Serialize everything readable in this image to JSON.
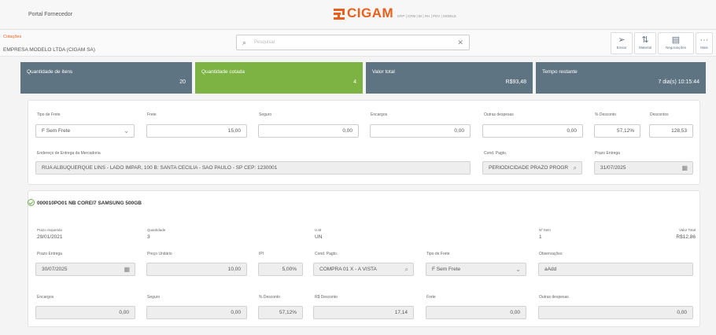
{
  "header": {
    "portal_title": "Portal Fornecedor",
    "brand": "CIGAM",
    "brand_subtitle": "ERP | CRM | BI | RH | PDV | MOBILE",
    "brand_color": "#e8601c"
  },
  "subheader": {
    "breadcrumb": "Cotações",
    "company": "EMPRESA MODELO LTDA (CIGAM SA)",
    "search_placeholder": "Pesquisar"
  },
  "toolbar": {
    "send_label": "Enviar",
    "send_icon": "send-icon",
    "material_label": "Material",
    "material_icon": "sort-arrows-icon",
    "negotiations_label": "Negociações",
    "negotiations_icon": "document-icon",
    "more_label": "Mais",
    "more_icon": "more-dots-icon"
  },
  "summary": {
    "items_label": "Quantidade de itens",
    "items_value": "20",
    "quoted_label": "Quantidade cotada",
    "quoted_value": "4",
    "total_label": "Valor total",
    "total_value": "R$93,48",
    "time_label": "Tempo restante",
    "time_value": "7 dia(s) 10:15:44",
    "colors": {
      "slate": "#5f7482",
      "green": "#7cb342"
    }
  },
  "quote": {
    "freight_type_label": "Tipo de Frete",
    "freight_type_value": "F Sem Frete",
    "freight_label": "Frete",
    "freight_value": "15,00",
    "insurance_label": "Seguro",
    "insurance_value": "0,00",
    "charges_label": "Encargos",
    "charges_value": "0,00",
    "other_label": "Outras despesas",
    "other_value": "0,00",
    "discount_pct_label": "% Desconto",
    "discount_pct_value": "57,12%",
    "discounts_label": "Descontos",
    "discounts_value": "128,53",
    "address_label": "Endereço de Entrega da Mercadoria",
    "address_value": "RUA ALBUQUERQUE LINS - LADO IMPAR, 100 B: SANTA CECILIA - SAO PAULO - SP CEP: 1230001",
    "payment_label": "Cond. Pagto.",
    "payment_value": "PERIODICIDADE PRAZO PROGR",
    "delivery_label": "Prazo Entrega",
    "delivery_value": "31/07/2025"
  },
  "item": {
    "title": "000010PO01 NB COREI7 SAMSUNG 500GB",
    "due_label": "Prazo requerido",
    "due_value": "29/01/2021",
    "qty_label": "Quantidade",
    "qty_value": "3",
    "unit_label": "U.M",
    "unit_value": "UN",
    "item_no_label": "Nº Item",
    "item_no_value": "1",
    "total_label": "Valor Total",
    "total_value": "R$12,86",
    "delivery_label": "Prazo Entrega",
    "delivery_value": "30/07/2025",
    "price_label": "Preço Unitário",
    "price_value": "10,00",
    "ipi_label": "IPI",
    "ipi_value": "5,00%",
    "payment_label": "Cond. Pagto.",
    "payment_value": "COMPRA 01 X - A VISTA",
    "freight_type_label": "Tipo de Frete",
    "freight_type_value": "F Sem Frete",
    "notes_label": "Observações",
    "notes_value": "aAdd",
    "charges_label": "Encargos",
    "charges_value": "0,00",
    "insurance_label": "Seguro",
    "insurance_value": "0,00",
    "discount_pct_label": "% Desconto",
    "discount_pct_value": "57,12%",
    "discount_rs_label": "R$ Desconto",
    "discount_rs_value": "17,14",
    "freight_label": "Frete",
    "freight_value": "0,00",
    "other_label": "Outras despesas",
    "other_value": "0,00"
  }
}
